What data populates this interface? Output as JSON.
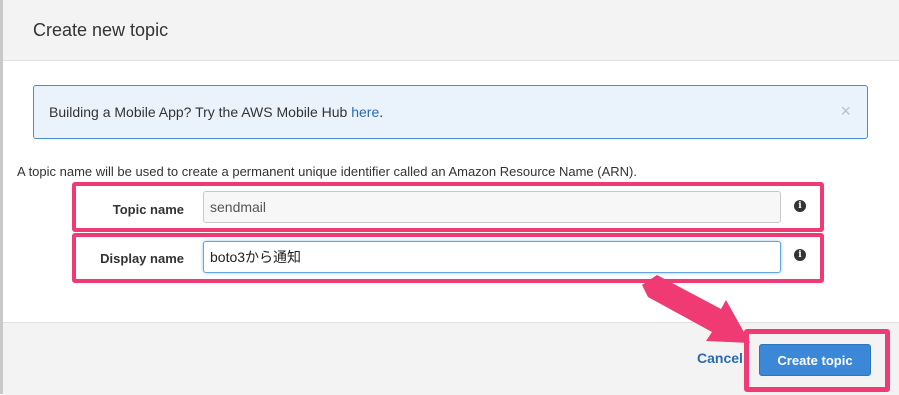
{
  "dialog": {
    "title": "Create new topic"
  },
  "info_alert": {
    "text": "Building a Mobile App? Try the AWS Mobile Hub ",
    "link_text": "here",
    "suffix": ".",
    "close_symbol": "×"
  },
  "description": "A topic name will be used to create a permanent unique identifier called an Amazon Resource Name (ARN).",
  "fields": {
    "topic_name": {
      "label": "Topic name",
      "value": "sendmail"
    },
    "display_name": {
      "label": "Display name",
      "value": "boto3から通知"
    },
    "info_glyph": "i"
  },
  "footer": {
    "cancel_label": "Cancel",
    "create_label": "Create topic"
  },
  "colors": {
    "highlight": "#f03a74",
    "primary_button": "#3b87d8",
    "link": "#2a6bb3"
  }
}
